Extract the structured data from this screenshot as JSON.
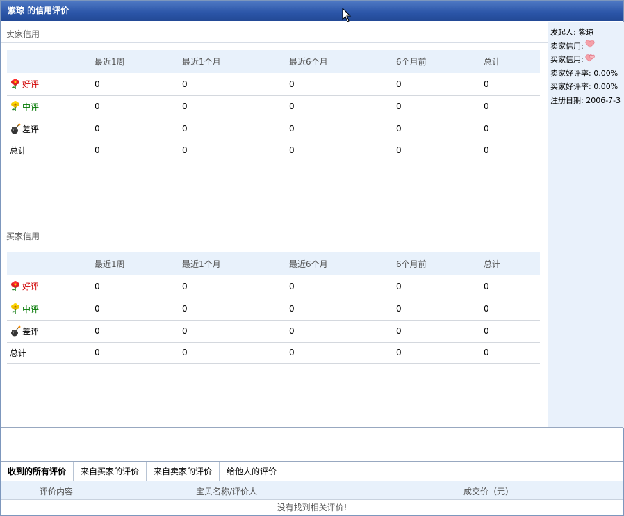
{
  "window": {
    "title": "紫琼 的信用评价"
  },
  "seller": {
    "section_title": "卖家信用",
    "headers": [
      "最近1周",
      "最近1个月",
      "最近6个月",
      "6个月前",
      "总计"
    ],
    "rows": [
      {
        "label": "好评",
        "icon": "flower-red-icon",
        "values": [
          "0",
          "0",
          "0",
          "0",
          "0"
        ]
      },
      {
        "label": "中评",
        "icon": "flower-yellow-icon",
        "values": [
          "0",
          "0",
          "0",
          "0",
          "0"
        ]
      },
      {
        "label": "差评",
        "icon": "bomb-icon",
        "values": [
          "0",
          "0",
          "0",
          "0",
          "0"
        ]
      },
      {
        "label": "总计",
        "icon": "",
        "values": [
          "0",
          "0",
          "0",
          "0",
          "0"
        ]
      }
    ]
  },
  "buyer": {
    "section_title": "买家信用",
    "headers": [
      "最近1周",
      "最近1个月",
      "最近6个月",
      "6个月前",
      "总计"
    ],
    "rows": [
      {
        "label": "好评",
        "icon": "flower-red-icon",
        "values": [
          "0",
          "0",
          "0",
          "0",
          "0"
        ]
      },
      {
        "label": "中评",
        "icon": "flower-yellow-icon",
        "values": [
          "0",
          "0",
          "0",
          "0",
          "0"
        ]
      },
      {
        "label": "差评",
        "icon": "bomb-icon",
        "values": [
          "0",
          "0",
          "0",
          "0",
          "0"
        ]
      },
      {
        "label": "总计",
        "icon": "",
        "values": [
          "0",
          "0",
          "0",
          "0",
          "0"
        ]
      }
    ]
  },
  "profile": {
    "initiator": "发起人: 紫琼",
    "seller_credit": "卖家信用:",
    "buyer_credit": "买家信用:",
    "seller_rate": "卖家好评率: 0.00%",
    "buyer_rate": "买家好评率: 0.00%",
    "register_date": "注册日期: 2006-7-3"
  },
  "tabs": [
    "收到的所有评价",
    "来自买家的评价",
    "来自卖家的评价",
    "给他人的评价"
  ],
  "list": {
    "col_content": "评价内容",
    "col_item": "宝贝名称/评价人",
    "col_price": "成交价（元）",
    "empty": "没有找到相关评价!"
  },
  "colors": {
    "titlebar": "#2b55a8",
    "good": "#d00000",
    "mid": "#007700",
    "header_bg": "#e8f1fb"
  }
}
